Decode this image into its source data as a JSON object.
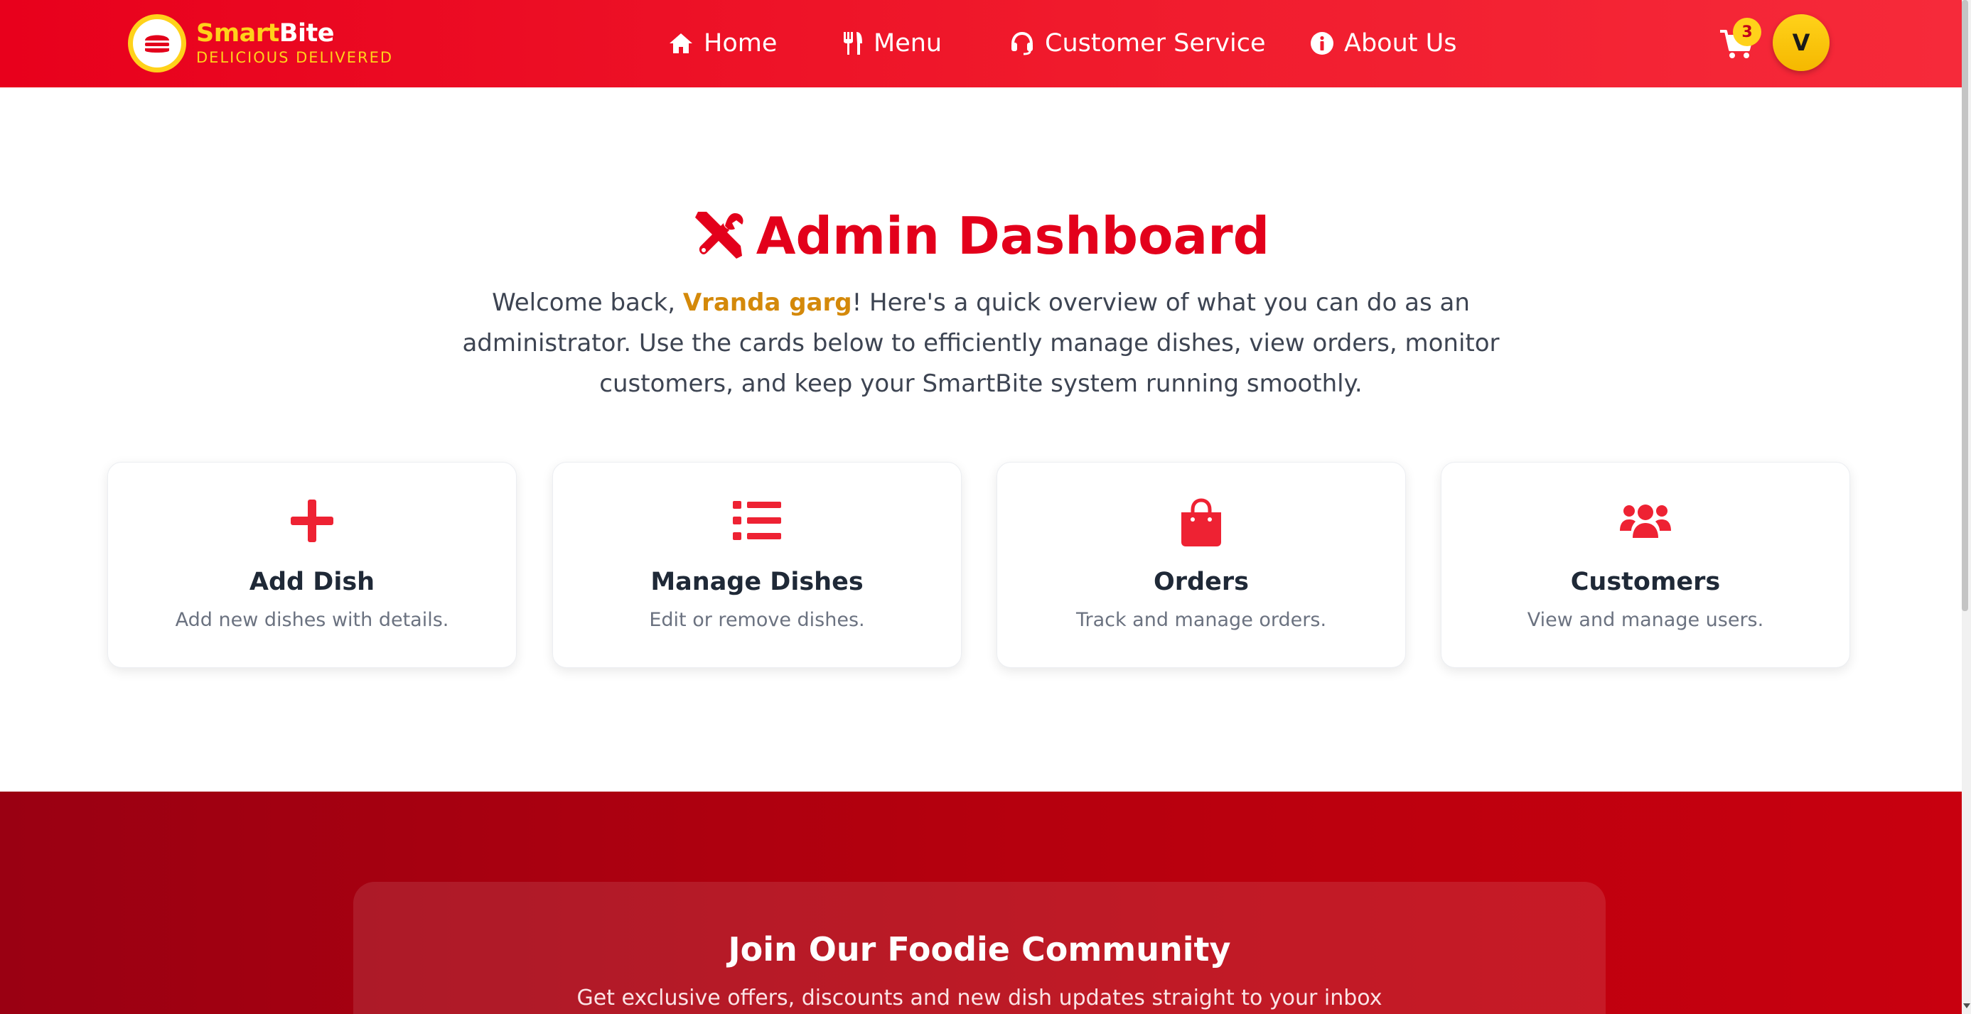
{
  "header": {
    "brand_part1": "Smart",
    "brand_part2": "Bite",
    "tagline": "DELICIOUS DELIVERED",
    "nav": [
      {
        "label": "Home",
        "icon": "home-icon"
      },
      {
        "label": "Menu",
        "icon": "utensils-icon"
      },
      {
        "label": "Customer Service",
        "icon": "headset-icon"
      },
      {
        "label": "About Us",
        "icon": "info-icon"
      }
    ],
    "cart_count": "3",
    "avatar_initial": "V"
  },
  "hero": {
    "title": "Admin Dashboard",
    "title_icon": "tools-icon",
    "intro_prefix": "Welcome back, ",
    "user_name": "Vranda garg",
    "intro_suffix": "! Here's a quick overview of what you can do as an administrator. Use the cards below to efficiently manage dishes, view orders, monitor customers, and keep your SmartBite system running smoothly."
  },
  "cards": [
    {
      "title": "Add Dish",
      "desc": "Add new dishes with details.",
      "icon": "plus-icon"
    },
    {
      "title": "Manage Dishes",
      "desc": "Edit or remove dishes.",
      "icon": "list-icon"
    },
    {
      "title": "Orders",
      "desc": "Track and manage orders.",
      "icon": "shopping-bag-icon"
    },
    {
      "title": "Customers",
      "desc": "View and manage users.",
      "icon": "users-icon"
    }
  ],
  "newsletter": {
    "title": "Join Our Foodie Community",
    "subtitle": "Get exclusive offers, discounts and new dish updates straight to your inbox"
  },
  "colors": {
    "brand_red": "#e3001b",
    "accent_yellow": "#ffd21a",
    "user_name": "#d4890a",
    "icon_red": "#ee2233"
  }
}
